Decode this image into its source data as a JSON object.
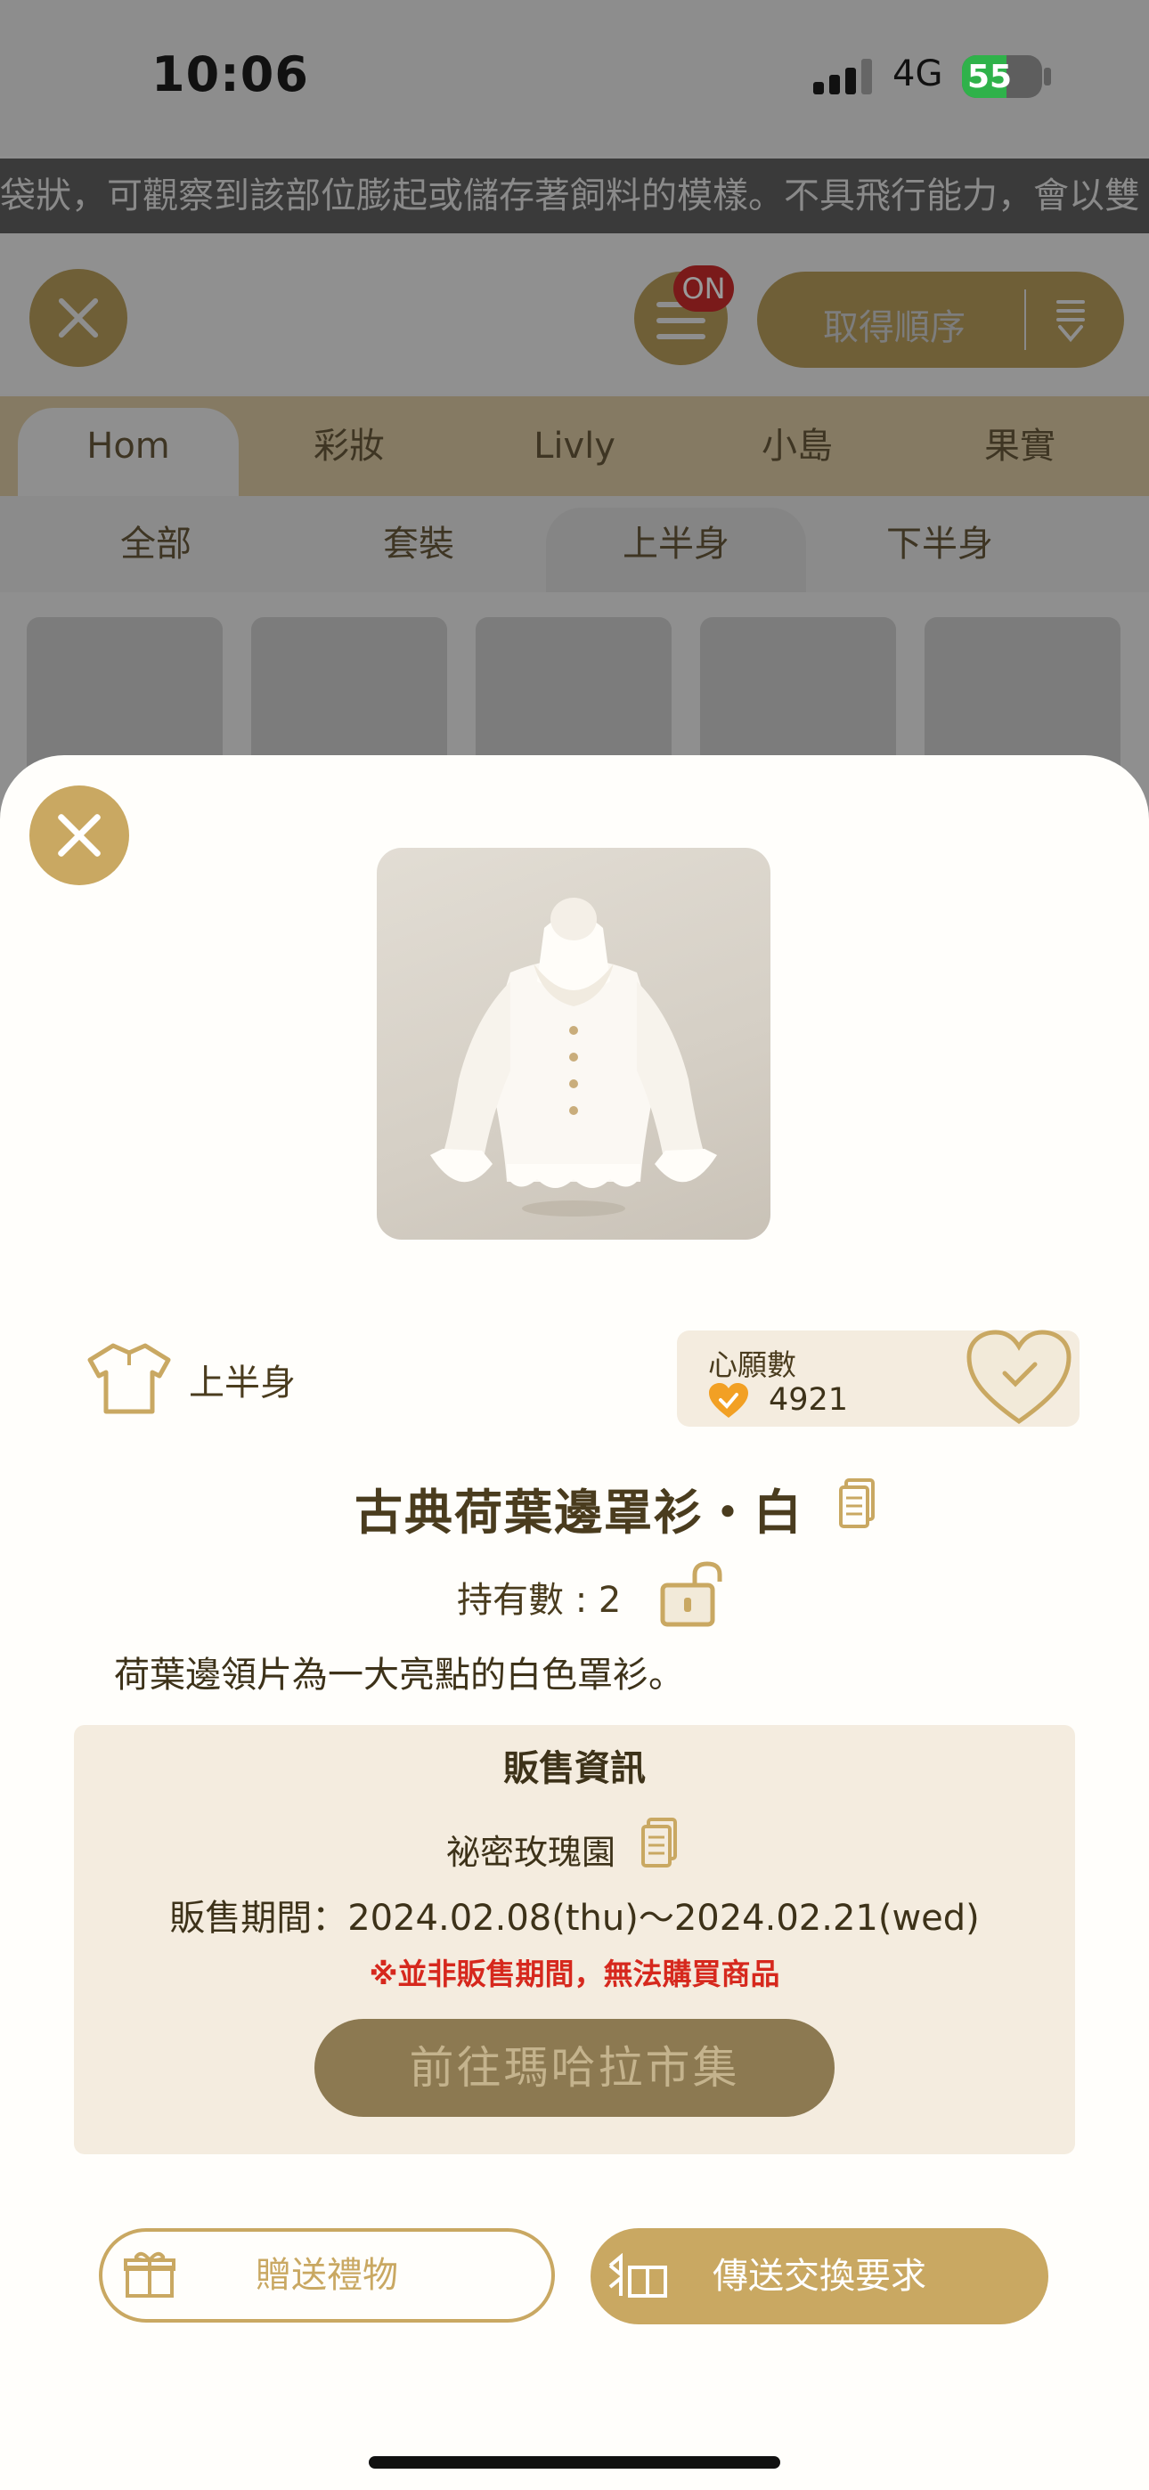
{
  "status_bar": {
    "time": "10:06",
    "network": "4G",
    "battery": "55",
    "battery_level": 0.55
  },
  "ticker": {
    "text": "袋狀，可觀察到該部位膨起或儲存著飼料的模樣。不具飛行能力，會以雙"
  },
  "toolbar": {
    "filter_badge": "ON",
    "sort_label": "取得順序"
  },
  "category_tabs": [
    {
      "label": "Hom",
      "active": true
    },
    {
      "label": "彩妝",
      "active": false
    },
    {
      "label": "Livly",
      "active": false
    },
    {
      "label": "小島",
      "active": false
    },
    {
      "label": "果實",
      "active": false
    }
  ],
  "sub_tabs": [
    {
      "label": "全部",
      "active": false
    },
    {
      "label": "套裝",
      "active": false
    },
    {
      "label": "上半身",
      "active": true
    },
    {
      "label": "下半身",
      "active": false
    }
  ],
  "item": {
    "category": "上半身",
    "wish_label": "心願數",
    "wish_count": "4921",
    "title": "古典荷葉邊罩衫・白",
    "owned": "持有數 : 2",
    "description": "荷葉邊領片為一大亮點的白色罩衫。"
  },
  "sale": {
    "header": "販售資訊",
    "shop": "祕密玫瑰園",
    "period": "販售期間：2024.02.08(thu)～2024.02.21(wed)",
    "warning": "※並非販售期間，無法購買商品",
    "market_button": "前往瑪哈拉市集"
  },
  "actions": {
    "gift": "贈送禮物",
    "trade": "傳送交換要求"
  },
  "colors": {
    "accent": "#c9a862",
    "warning": "#d6281d",
    "text": "#4a3c1e",
    "panel": "#f4ecdf"
  }
}
